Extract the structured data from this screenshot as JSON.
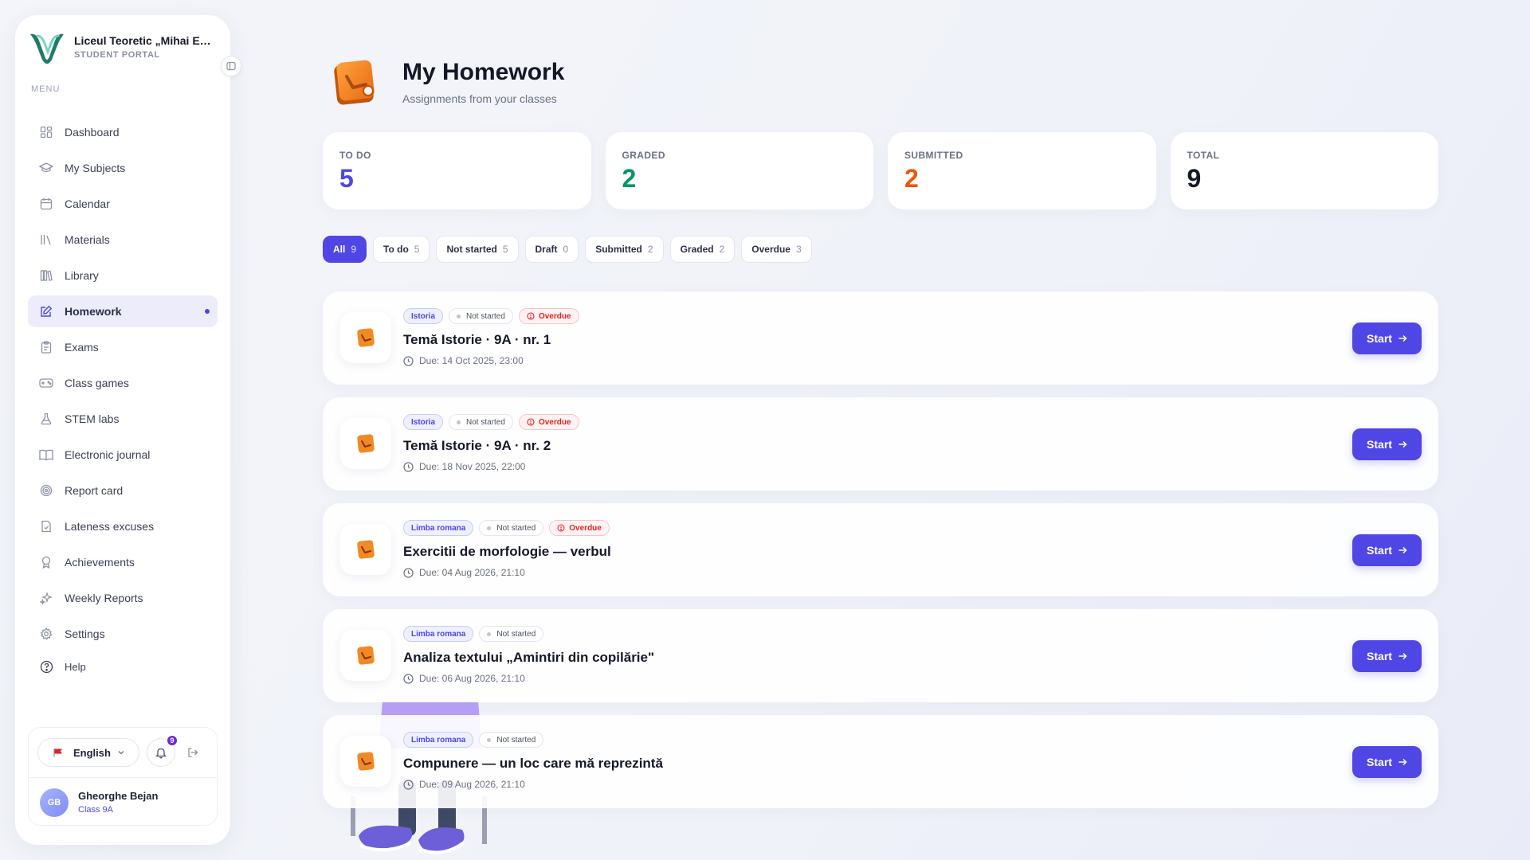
{
  "brand": {
    "name": "Liceul Teoretic „Mihai Emi...",
    "portal": "STUDENT PORTAL"
  },
  "menu_label": "MENU",
  "nav": {
    "items": [
      {
        "label": "Dashboard",
        "icon": "dashboard-icon"
      },
      {
        "label": "My Subjects",
        "icon": "graduation-cap-icon"
      },
      {
        "label": "Calendar",
        "icon": "calendar-icon"
      },
      {
        "label": "Materials",
        "icon": "books-icon"
      },
      {
        "label": "Library",
        "icon": "library-icon"
      },
      {
        "label": "Homework",
        "icon": "homework-icon"
      },
      {
        "label": "Exams",
        "icon": "clipboard-icon"
      },
      {
        "label": "Class games",
        "icon": "gamepad-icon"
      },
      {
        "label": "STEM labs",
        "icon": "flask-icon"
      },
      {
        "label": "Electronic journal",
        "icon": "book-open-icon"
      },
      {
        "label": "Report card",
        "icon": "target-icon"
      },
      {
        "label": "Lateness excuses",
        "icon": "document-icon"
      },
      {
        "label": "Achievements",
        "icon": "award-icon"
      },
      {
        "label": "Weekly Reports",
        "icon": "sparkles-icon"
      },
      {
        "label": "Settings",
        "icon": "gear-icon"
      }
    ],
    "help": "Help"
  },
  "footer": {
    "language": "English",
    "notifications_count": "9",
    "user_initials": "GB",
    "user_name": "Gheorghe Bejan",
    "user_class": "Class 9A"
  },
  "page": {
    "title": "My Homework",
    "subtitle": "Assignments from your classes"
  },
  "stats": [
    {
      "label": "TO DO",
      "value": "5",
      "color": "#4f46e5"
    },
    {
      "label": "GRADED",
      "value": "2",
      "color": "#059669"
    },
    {
      "label": "SUBMITTED",
      "value": "2",
      "color": "#ea580c"
    },
    {
      "label": "TOTAL",
      "value": "9",
      "color": "#151827"
    }
  ],
  "filters": [
    {
      "label": "All",
      "count": "9"
    },
    {
      "label": "To do",
      "count": "5"
    },
    {
      "label": "Not started",
      "count": "5"
    },
    {
      "label": "Draft",
      "count": "0"
    },
    {
      "label": "Submitted",
      "count": "2"
    },
    {
      "label": "Graded",
      "count": "2"
    },
    {
      "label": "Overdue",
      "count": "3"
    }
  ],
  "homework": [
    {
      "subject": "Istoria",
      "status": "Not started",
      "overdue": "Overdue",
      "title": "Temă Istorie · 9A · nr. 1",
      "due": "Due: 14 Oct 2025, 23:00",
      "action": "Start"
    },
    {
      "subject": "Istoria",
      "status": "Not started",
      "overdue": "Overdue",
      "title": "Temă Istorie · 9A · nr. 2",
      "due": "Due: 18 Nov 2025, 22:00",
      "action": "Start"
    },
    {
      "subject": "Limba romana",
      "status": "Not started",
      "overdue": "Overdue",
      "title": "Exercitii de morfologie — verbul",
      "due": "Due: 04 Aug 2026, 21:10",
      "action": "Start"
    },
    {
      "subject": "Limba romana",
      "status": "Not started",
      "title": "Analiza textului „Amintiri din copilărie\"",
      "due": "Due: 06 Aug 2026, 21:10",
      "action": "Start"
    },
    {
      "subject": "Limba romana",
      "status": "Not started",
      "title": "Compunere — un loc care mă reprezintă",
      "due": "Due: 09 Aug 2026, 21:10",
      "action": "Start"
    }
  ],
  "colors": {
    "accent": "#4f46e5",
    "overdue": "#dc2626",
    "homework_icon": "#f08a24"
  }
}
